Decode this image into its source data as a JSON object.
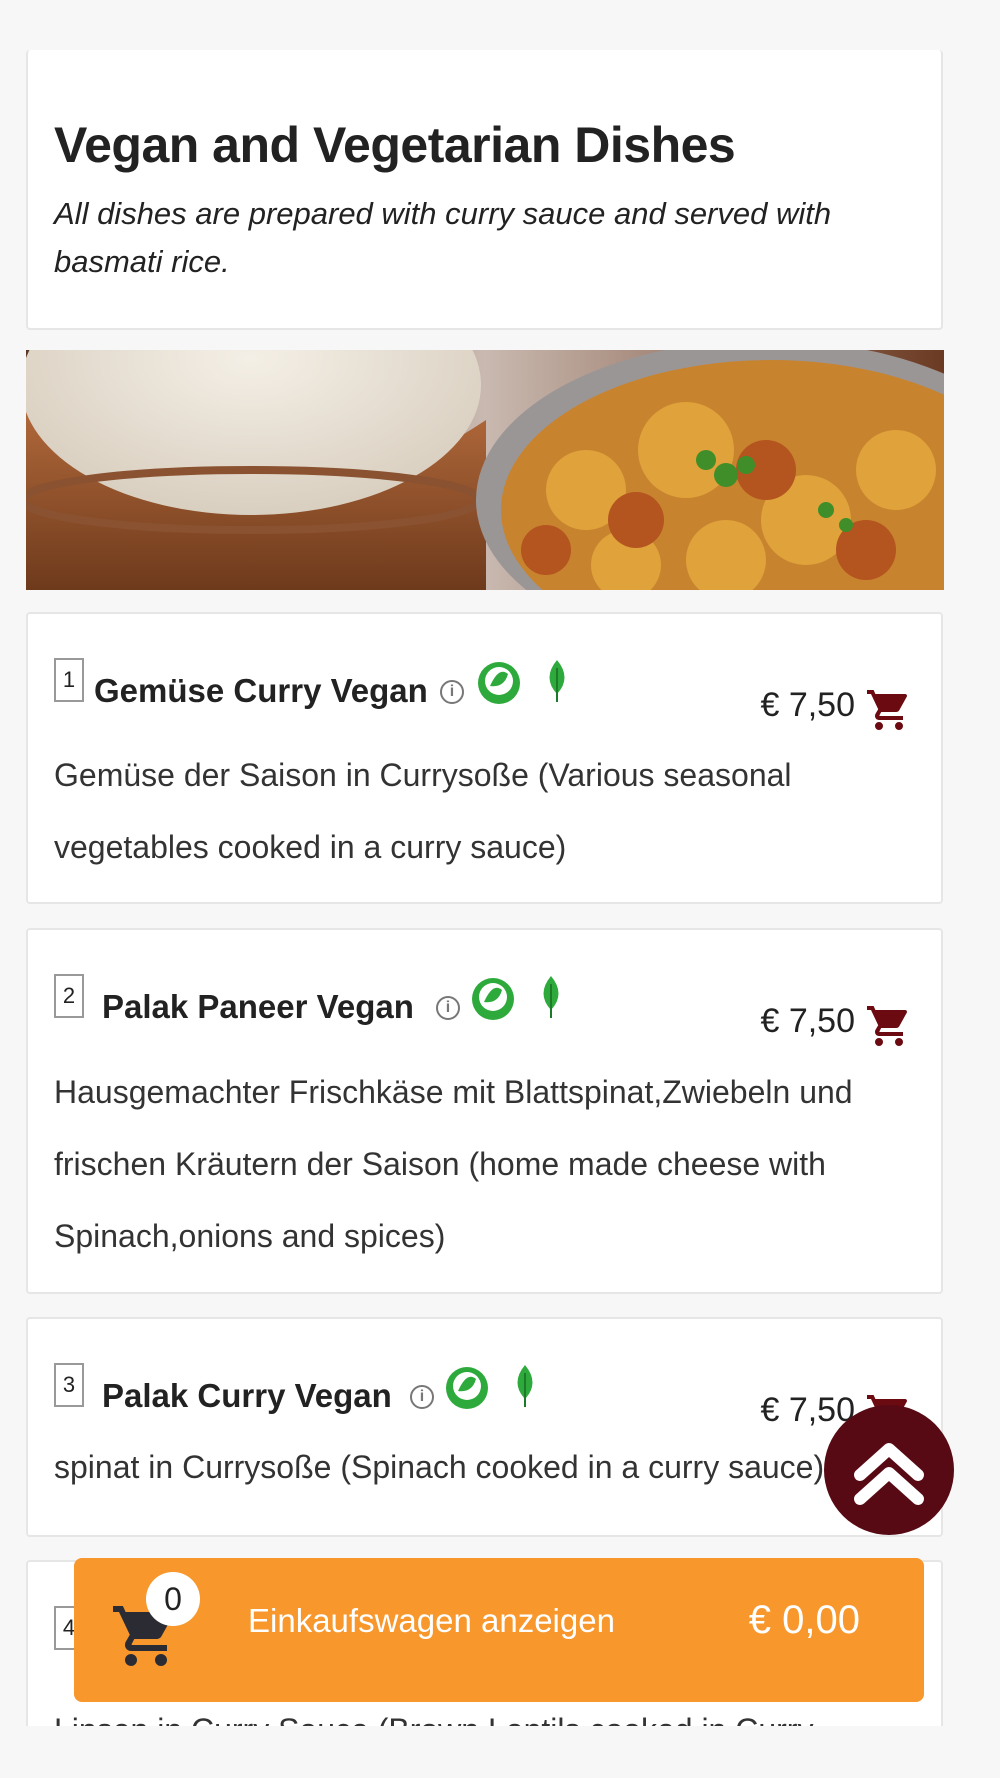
{
  "section": {
    "title": "Vegan and Vegetarian Dishes",
    "subtitle": "All dishes are prepared with curry sauce and served with basmati rice."
  },
  "dishes": [
    {
      "number": "1",
      "name": "Gemüse Curry Vegan",
      "price": "€ 7,50",
      "description": "Gemüse der Saison in Currysoße (Various seasonal vegetables cooked in a curry sauce)"
    },
    {
      "number": "2",
      "name": "Palak Paneer Vegan",
      "price": "€ 7,50",
      "description": "Hausgemachter Frischkäse mit Blattspinat,Zwiebeln und frischen Kräutern der Saison (home made cheese with Spinach,onions and spices)"
    },
    {
      "number": "3",
      "name": "Palak Curry Vegan",
      "price": "€ 7,50",
      "description": "spinat in Currysoße (Spinach cooked in a curry sauce)"
    },
    {
      "number": "4",
      "name": "",
      "price": "",
      "description": "Linsen in Curry Sauce (Brown Lentils cooked in Curry"
    }
  ],
  "cart": {
    "count": "0",
    "label": "Einkaufswagen anzeigen",
    "total": "€ 0,00"
  },
  "colors": {
    "accent_orange": "#f7972c",
    "scroll_button": "#570a14",
    "cart_icon": "#6b0a10",
    "vegan_green": "#2eaa3c"
  },
  "icons": [
    "info-icon",
    "vegan-badge-icon",
    "leaf-icon",
    "cart-icon",
    "double-chevron-up-icon"
  ]
}
